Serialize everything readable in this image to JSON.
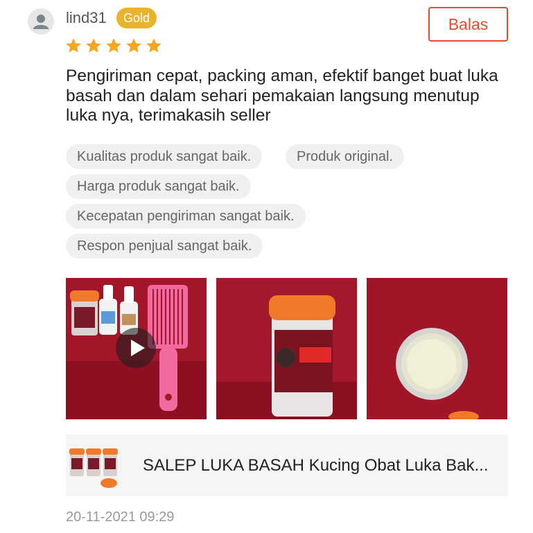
{
  "review": {
    "user": {
      "name": "lind31",
      "badge": "Gold",
      "avatar_icon": "person-icon"
    },
    "reply_button_label": "Balas",
    "rating": {
      "stars": 5,
      "max": 5,
      "star_color": "#f5a623"
    },
    "text": "Pengiriman cepat, packing aman, efektif banget buat luka basah dan dalam sehari pemakaian langsung menutup luka nya, terimakasih seller",
    "tags": [
      "Kualitas produk sangat baik.",
      "Produk original.",
      "Harga produk sangat baik.",
      "Kecepatan pengiriman sangat baik.",
      "Respon penjual sangat baik."
    ],
    "media": [
      {
        "type": "video",
        "label": "video-thumbnail-products"
      },
      {
        "type": "photo",
        "label": "photo-salep-jar"
      },
      {
        "type": "photo",
        "label": "photo-open-jar"
      }
    ],
    "product": {
      "name": "SALEP LUKA BASAH Kucing Obat Luka Bak..."
    },
    "timestamp": "20-11-2021 09:29"
  },
  "colors": {
    "accent": "#e14d2a",
    "badge": "#e9b32b",
    "tag_bg": "#f0f0f0",
    "muted_text": "#999999"
  }
}
